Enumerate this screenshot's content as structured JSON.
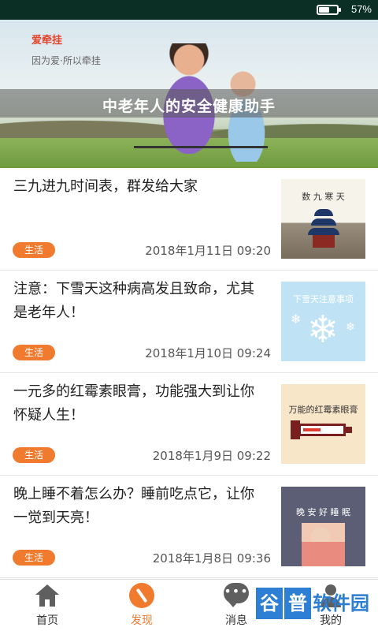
{
  "status_bar": {
    "battery_percent": "57%",
    "battery_level": 0.57
  },
  "banner": {
    "brand": "爱牵挂",
    "slogan": "因为爱·所以牵挂",
    "title": "中老年人的安全健康助手"
  },
  "articles": [
    {
      "title": "三九进九时间表，群发给大家",
      "tag": "生活",
      "date": "2018年1月11日 09:20",
      "thumb_text": "数 九 寒 天",
      "thumb_icon": "temple-of-heaven-image"
    },
    {
      "title": "注意：下雪天这种病高发且致命，尤其是老年人！",
      "tag": "生活",
      "date": "2018年1月10日 09:24",
      "thumb_text": "下雪天注意事项",
      "thumb_icon": "snowflake-image"
    },
    {
      "title": "一元多的红霉素眼膏，功能强大到让你怀疑人生！",
      "tag": "生活",
      "date": "2018年1月9日 09:22",
      "thumb_text": "万能的红霉素眼膏",
      "thumb_icon": "ointment-tube-image"
    },
    {
      "title": "晚上睡不着怎么办？睡前吃点它，让你一觉到天亮！",
      "tag": "生活",
      "date": "2018年1月8日 09:36",
      "thumb_text": "晚 安 好 睡 眠",
      "thumb_icon": "sleeping-person-image"
    }
  ],
  "bottom_nav": {
    "active": "发现",
    "items": [
      {
        "label": "首页",
        "icon": "home-icon"
      },
      {
        "label": "发现",
        "icon": "compass-icon"
      },
      {
        "label": "消息",
        "icon": "message-icon"
      },
      {
        "label": "我的",
        "icon": "person-icon"
      }
    ]
  },
  "watermark": {
    "box1": "谷",
    "box2": "普",
    "text": "软件园"
  },
  "colors": {
    "accent": "#f07a2e",
    "status_bar": "#0b2f24",
    "brand_red": "#e2452c",
    "watermark_blue": "#2d7fd6"
  }
}
